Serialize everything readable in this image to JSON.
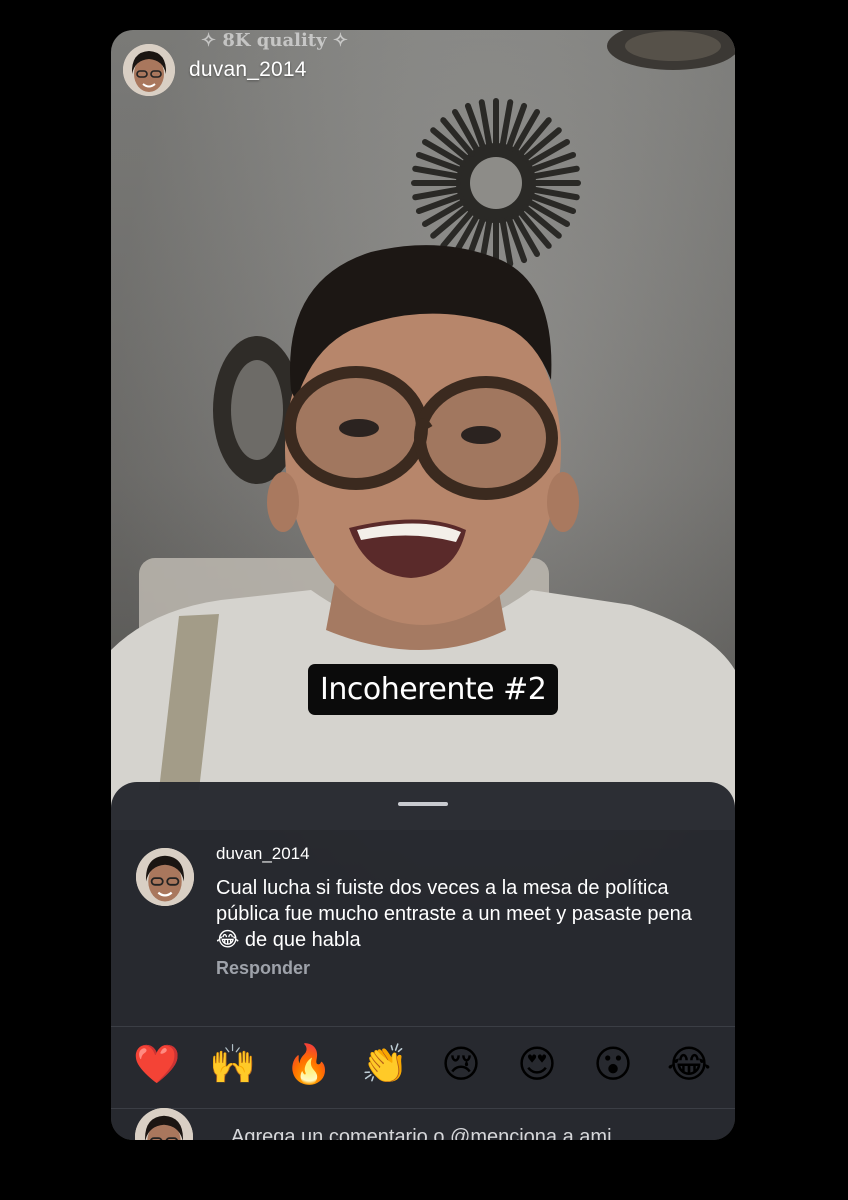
{
  "story": {
    "username": "duvan_2014",
    "quality_label": "✧ 8K quality ✧",
    "caption": "Incoherente #2"
  },
  "comment": {
    "username": "duvan_2014",
    "text": "Cual lucha si fuiste dos veces a la mesa de política pública fue mucho entraste a un meet y pasaste pena 😂 de que habla",
    "reply_label": "Responder"
  },
  "reactions": [
    "❤️",
    "🙌",
    "🔥",
    "👏",
    "😢",
    "😍",
    "😮",
    "😂"
  ],
  "composer": {
    "placeholder": "Agrega un comentario o @menciona a ami..."
  },
  "colors": {
    "sheet_bg": "#26282e",
    "secondary_text": "#9ea2aa"
  }
}
